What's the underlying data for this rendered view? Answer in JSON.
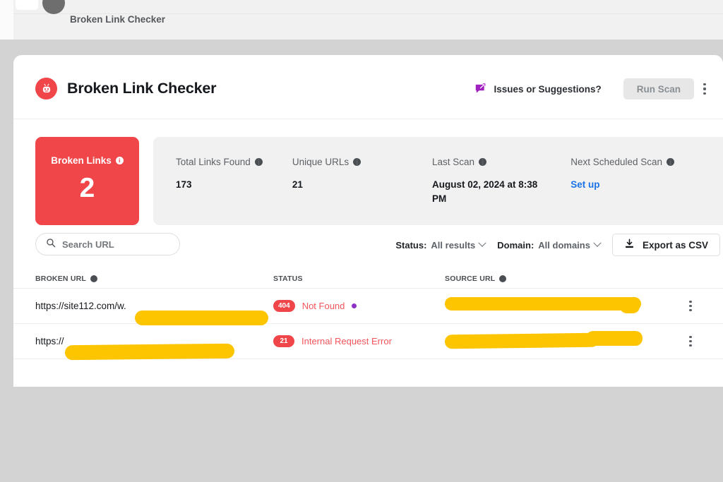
{
  "breadcrumb": {
    "label": "Broken Link Checker"
  },
  "header": {
    "logo_icon": "broken-link-robot-icon",
    "title": "Broken Link Checker",
    "issues_icon": "feedback-pencil-bubble-icon",
    "issues_label": "Issues or Suggestions?",
    "run_scan_label": "Run Scan",
    "kebab_icon": "more-vertical-icon"
  },
  "stats": {
    "broken": {
      "label": "Broken Links",
      "value": "2",
      "info_icon": "info-icon"
    },
    "items": [
      {
        "label": "Total Links Found",
        "value": "173",
        "info_icon": "info-icon",
        "is_link": false
      },
      {
        "label": "Unique URLs",
        "value": "21",
        "info_icon": "info-icon",
        "is_link": false
      },
      {
        "label": "Last Scan",
        "value": "August 02, 2024 at 8:38 PM",
        "info_icon": "info-icon",
        "is_link": false
      },
      {
        "label": "Next Scheduled Scan",
        "value": "Set up",
        "info_icon": "info-icon",
        "is_link": true
      }
    ]
  },
  "toolbar": {
    "search_placeholder": "Search URL",
    "search_value": "",
    "search_icon": "search-icon",
    "status_filter": {
      "key": "Status:",
      "value": "All results",
      "chevron_icon": "chevron-down-icon"
    },
    "domain_filter": {
      "key": "Domain:",
      "value": "All domains",
      "chevron_icon": "chevron-down-icon"
    },
    "export": {
      "label": "Export as CSV",
      "icon": "download-csv-icon"
    }
  },
  "table": {
    "headers": {
      "broken_url": "BROKEN URL",
      "status": "STATUS",
      "source_url": "SOURCE URL",
      "info_icon": "info-icon"
    },
    "rows": [
      {
        "broken_url": "https://site112.com/w.",
        "broken_url_redacted": true,
        "status_code": "404",
        "status_text": "Not Found",
        "has_status_dot": true,
        "source_url": "",
        "source_url_redacted": true,
        "kebab_icon": "more-vertical-icon"
      },
      {
        "broken_url": "https://",
        "broken_url_redacted": true,
        "status_code": "21",
        "status_text": "Internal Request Error",
        "has_status_dot": false,
        "source_url": "",
        "source_url_redacted": true,
        "kebab_icon": "more-vertical-icon"
      }
    ]
  },
  "colors": {
    "brand_red": "#f0464a",
    "link_blue": "#1a73e8",
    "redaction_yellow": "#fdc500",
    "status_dot_purple": "#8d31c7",
    "issues_purple": "#a020c0",
    "page_background": "#d3d3d3"
  }
}
